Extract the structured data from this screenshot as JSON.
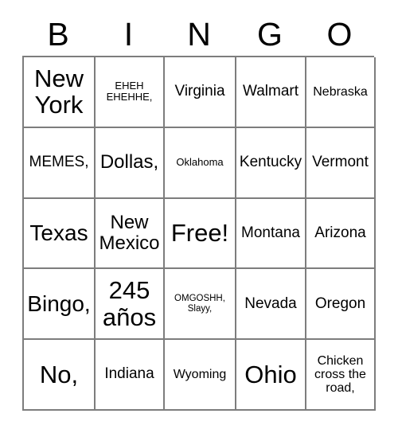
{
  "card": {
    "title": "BINGO",
    "headers": [
      "B",
      "I",
      "N",
      "G",
      "O"
    ],
    "rows": [
      [
        {
          "text": "New\nYork",
          "size": "fs-xxl"
        },
        {
          "text": "EHEH\nEHEHHE,",
          "size": "fs-xs"
        },
        {
          "text": "Virginia",
          "size": "fs-md"
        },
        {
          "text": "Walmart",
          "size": "fs-md"
        },
        {
          "text": "Nebraska",
          "size": "fs-sm"
        }
      ],
      [
        {
          "text": "MEMES,",
          "size": "fs-md"
        },
        {
          "text": "Dollas,",
          "size": "fs-lg"
        },
        {
          "text": "Oklahoma",
          "size": "fs-xs"
        },
        {
          "text": "Kentucky",
          "size": "fs-md"
        },
        {
          "text": "Vermont",
          "size": "fs-md"
        }
      ],
      [
        {
          "text": "Texas",
          "size": "fs-xl"
        },
        {
          "text": "New\nMexico",
          "size": "fs-lg"
        },
        {
          "text": "Free!",
          "size": "fs-xxl"
        },
        {
          "text": "Montana",
          "size": "fs-md"
        },
        {
          "text": "Arizona",
          "size": "fs-md"
        }
      ],
      [
        {
          "text": "Bingo,",
          "size": "fs-xl"
        },
        {
          "text": "245\naños",
          "size": "fs-xxl"
        },
        {
          "text": "OMGOSHH,\nSlayy,",
          "size": "fs-xxs"
        },
        {
          "text": "Nevada",
          "size": "fs-md"
        },
        {
          "text": "Oregon",
          "size": "fs-md"
        }
      ],
      [
        {
          "text": "No,",
          "size": "fs-xxl"
        },
        {
          "text": "Indiana",
          "size": "fs-md"
        },
        {
          "text": "Wyoming",
          "size": "fs-sm"
        },
        {
          "text": "Ohio",
          "size": "fs-xxl"
        },
        {
          "text": "Chicken\ncross the\nroad,",
          "size": "fs-sm"
        }
      ]
    ],
    "free_space": {
      "row": 2,
      "col": 2,
      "label": "Free!"
    },
    "colors": {
      "text": "#000000",
      "border": "#7d7d7d",
      "background": "#ffffff"
    }
  }
}
